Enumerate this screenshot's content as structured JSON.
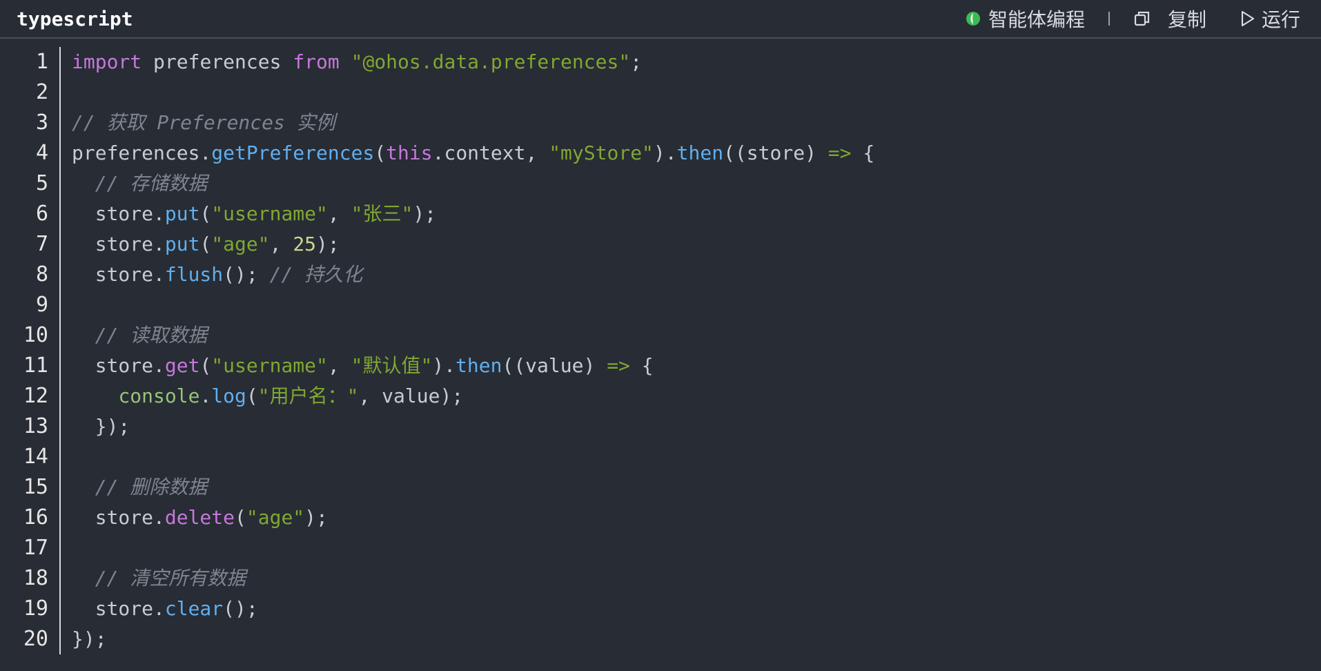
{
  "header": {
    "language": "typescript",
    "ai_label": "智能体编程",
    "copy_label": "复制",
    "run_label": "运行"
  },
  "colors": {
    "background": "#282c34",
    "keyword": "#c678dd",
    "string": "#7fa832",
    "function": "#61afef",
    "comment": "#7f848e",
    "text": "#c8ccd4",
    "ai_icon": "#3cba54"
  },
  "icons": {
    "ai": "ai-agent-icon",
    "copy": "copy-icon",
    "run": "play-icon"
  },
  "code": {
    "lines": [
      {
        "n": "1",
        "tokens": [
          [
            "kw",
            "import"
          ],
          [
            "pl",
            " preferences "
          ],
          [
            "kw",
            "from"
          ],
          [
            "pl",
            " "
          ],
          [
            "str",
            "\"@ohos.data.preferences\""
          ],
          [
            "pl",
            ";"
          ]
        ]
      },
      {
        "n": "2",
        "tokens": []
      },
      {
        "n": "3",
        "tokens": [
          [
            "cmt",
            "// 获取 Preferences 实例"
          ]
        ]
      },
      {
        "n": "4",
        "tokens": [
          [
            "pl",
            "preferences."
          ],
          [
            "fn",
            "getPreferences"
          ],
          [
            "pl",
            "("
          ],
          [
            "kw",
            "this"
          ],
          [
            "pl",
            ".context, "
          ],
          [
            "str",
            "\"myStore\""
          ],
          [
            "pl",
            ")."
          ],
          [
            "fn",
            "then"
          ],
          [
            "pl",
            "((store) "
          ],
          [
            "arrow",
            "=>"
          ],
          [
            "pl",
            " {"
          ]
        ]
      },
      {
        "n": "5",
        "tokens": [
          [
            "pl",
            "  "
          ],
          [
            "cmt",
            "// 存储数据"
          ]
        ]
      },
      {
        "n": "6",
        "tokens": [
          [
            "pl",
            "  store."
          ],
          [
            "fn",
            "put"
          ],
          [
            "pl",
            "("
          ],
          [
            "str",
            "\"username\""
          ],
          [
            "pl",
            ", "
          ],
          [
            "str",
            "\"张三\""
          ],
          [
            "pl",
            ");"
          ]
        ]
      },
      {
        "n": "7",
        "tokens": [
          [
            "pl",
            "  store."
          ],
          [
            "fn",
            "put"
          ],
          [
            "pl",
            "("
          ],
          [
            "str",
            "\"age\""
          ],
          [
            "pl",
            ", "
          ],
          [
            "num",
            "25"
          ],
          [
            "pl",
            ");"
          ]
        ]
      },
      {
        "n": "8",
        "tokens": [
          [
            "pl",
            "  store."
          ],
          [
            "fn",
            "flush"
          ],
          [
            "pl",
            "(); "
          ],
          [
            "cmt",
            "// 持久化"
          ]
        ]
      },
      {
        "n": "9",
        "tokens": []
      },
      {
        "n": "10",
        "tokens": [
          [
            "pl",
            "  "
          ],
          [
            "cmt",
            "// 读取数据"
          ]
        ]
      },
      {
        "n": "11",
        "tokens": [
          [
            "pl",
            "  store."
          ],
          [
            "kw",
            "get"
          ],
          [
            "pl",
            "("
          ],
          [
            "str",
            "\"username\""
          ],
          [
            "pl",
            ", "
          ],
          [
            "str",
            "\"默认值\""
          ],
          [
            "pl",
            ")."
          ],
          [
            "fn",
            "then"
          ],
          [
            "pl",
            "((value) "
          ],
          [
            "arrow",
            "=>"
          ],
          [
            "pl",
            " {"
          ]
        ]
      },
      {
        "n": "12",
        "tokens": [
          [
            "pl",
            "    "
          ],
          [
            "con",
            "console"
          ],
          [
            "pl",
            "."
          ],
          [
            "fn",
            "log"
          ],
          [
            "pl",
            "("
          ],
          [
            "str",
            "\"用户名：\""
          ],
          [
            "pl",
            ", value);"
          ]
        ]
      },
      {
        "n": "13",
        "tokens": [
          [
            "pl",
            "  });"
          ]
        ]
      },
      {
        "n": "14",
        "tokens": []
      },
      {
        "n": "15",
        "tokens": [
          [
            "pl",
            "  "
          ],
          [
            "cmt",
            "// 删除数据"
          ]
        ]
      },
      {
        "n": "16",
        "tokens": [
          [
            "pl",
            "  store."
          ],
          [
            "kw",
            "delete"
          ],
          [
            "pl",
            "("
          ],
          [
            "str",
            "\"age\""
          ],
          [
            "pl",
            ");"
          ]
        ]
      },
      {
        "n": "17",
        "tokens": []
      },
      {
        "n": "18",
        "tokens": [
          [
            "pl",
            "  "
          ],
          [
            "cmt",
            "// 清空所有数据"
          ]
        ]
      },
      {
        "n": "19",
        "tokens": [
          [
            "pl",
            "  store."
          ],
          [
            "fn",
            "clear"
          ],
          [
            "pl",
            "();"
          ]
        ]
      },
      {
        "n": "20",
        "tokens": [
          [
            "pl",
            "});"
          ]
        ]
      }
    ]
  }
}
